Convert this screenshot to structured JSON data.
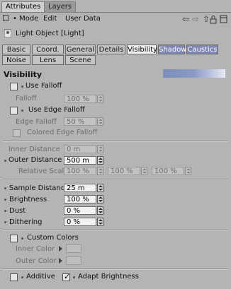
{
  "window_tabs": [
    "Attributes",
    "Layers"
  ],
  "menu": {
    "mode": "Mode",
    "edit": "Edit",
    "userdata": "User Data"
  },
  "object_title": "Light Object [Light]",
  "tabs_row1": [
    "Basic",
    "Coord.",
    "General",
    "Details",
    "Visibility",
    "Shadow",
    "Caustics"
  ],
  "tabs_row2": [
    "Noise",
    "Lens",
    "Scene"
  ],
  "section": "Visibility",
  "use_falloff": {
    "label": "Use Falloff",
    "checked": false
  },
  "falloff": {
    "label": "Falloff",
    "value": "100 %"
  },
  "use_edge_falloff": {
    "label": "Use Edge Falloff",
    "checked": false
  },
  "edge_falloff": {
    "label": "Edge Falloff",
    "value": "50 %"
  },
  "colored_edge_falloff": {
    "label": "Colored Edge Falloff",
    "checked": false
  },
  "inner_distance": {
    "label": "Inner Distance",
    "value": "0 m"
  },
  "outer_distance": {
    "label": "Outer Distance",
    "value": "500 m"
  },
  "relative_scale": {
    "label": "Relative Scale",
    "values": [
      "100 %",
      "100 %",
      "100 %"
    ]
  },
  "sample_distance": {
    "label": "Sample Distance",
    "value": "25 m"
  },
  "brightness": {
    "label": "Brightness",
    "value": "100 %"
  },
  "dust": {
    "label": "Dust",
    "value": "0 %"
  },
  "dithering": {
    "label": "Dithering",
    "value": "0 %"
  },
  "custom_colors": {
    "label": "Custom Colors",
    "checked": false
  },
  "inner_color": {
    "label": "Inner Color"
  },
  "outer_color": {
    "label": "Outer Color"
  },
  "additive": {
    "label": "Additive",
    "checked": false
  },
  "adapt_brightness": {
    "label": "Adapt Brightness",
    "checked": true
  },
  "colors": {
    "active_tab": "#f2f2f2",
    "highlight_tab": "#7e86b4",
    "panel": "#b4b4b4"
  },
  "icons": [
    "back-arrow-icon",
    "forward-arrow-icon",
    "up-arrow-icon",
    "lock-icon",
    "new-panel-icon",
    "light-object-icon"
  ]
}
